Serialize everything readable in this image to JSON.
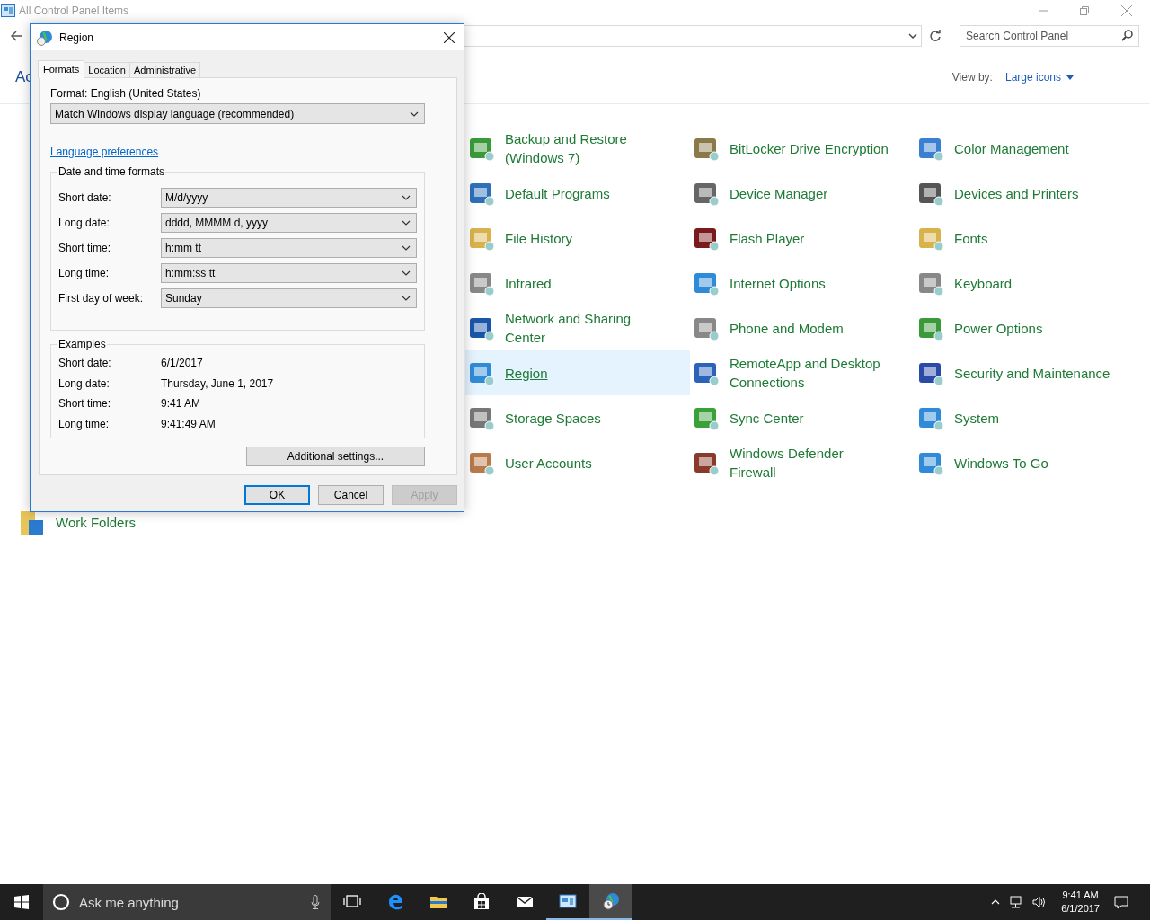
{
  "window": {
    "title": "All Control Panel Items",
    "search": {
      "placeholder": "Search Control Panel"
    }
  },
  "header": {
    "title": "Ac",
    "view_by_label": "View by:",
    "view_by_value": "Large icons"
  },
  "items": [
    {
      "label": "Backup and Restore (Windows 7)",
      "selected": false
    },
    {
      "label": "BitLocker Drive Encryption",
      "selected": false
    },
    {
      "label": "Color Management",
      "selected": false
    },
    {
      "label": "Default Programs",
      "selected": false
    },
    {
      "label": "Device Manager",
      "selected": false
    },
    {
      "label": "Devices and Printers",
      "selected": false
    },
    {
      "label": "File History",
      "selected": false
    },
    {
      "label": "Flash Player",
      "selected": false
    },
    {
      "label": "Fonts",
      "selected": false
    },
    {
      "label": "Infrared",
      "selected": false
    },
    {
      "label": "Internet Options",
      "selected": false
    },
    {
      "label": "Keyboard",
      "selected": false
    },
    {
      "label": "Network and Sharing Center",
      "selected": false
    },
    {
      "label": "Phone and Modem",
      "selected": false
    },
    {
      "label": "Power Options",
      "selected": false
    },
    {
      "label": "Region",
      "selected": true
    },
    {
      "label": "RemoteApp and Desktop Connections",
      "selected": false
    },
    {
      "label": "Security and Maintenance",
      "selected": false
    },
    {
      "label": "Storage Spaces",
      "selected": false
    },
    {
      "label": "Sync Center",
      "selected": false
    },
    {
      "label": "System",
      "selected": false
    },
    {
      "label": "User Accounts",
      "selected": false
    },
    {
      "label": "Windows Defender Firewall",
      "selected": false
    },
    {
      "label": "Windows To Go",
      "selected": false
    }
  ],
  "partial_items": [
    {
      "label": "Work Folders"
    }
  ],
  "dialog": {
    "title": "Region",
    "tabs": [
      {
        "label": "Formats",
        "selected": true
      },
      {
        "label": "Location",
        "selected": false
      },
      {
        "label": "Administrative",
        "selected": false
      }
    ],
    "format_label": "Format: English (United States)",
    "format_value": "Match Windows display language (recommended)",
    "link": "Language preferences",
    "formats_group": {
      "title": "Date and time formats",
      "rows": [
        {
          "label": "Short date:",
          "value": "M/d/yyyy"
        },
        {
          "label": "Long date:",
          "value": "dddd, MMMM d, yyyy"
        },
        {
          "label": "Short time:",
          "value": "h:mm tt"
        },
        {
          "label": "Long time:",
          "value": "h:mm:ss tt"
        },
        {
          "label": "First day of week:",
          "value": "Sunday"
        }
      ]
    },
    "examples_group": {
      "title": "Examples",
      "rows": [
        {
          "label": "Short date:",
          "value": "6/1/2017"
        },
        {
          "label": "Long date:",
          "value": "Thursday, June 1, 2017"
        },
        {
          "label": "Short time:",
          "value": "9:41 AM"
        },
        {
          "label": "Long time:",
          "value": "9:41:49 AM"
        }
      ]
    },
    "additional_button": "Additional settings...",
    "buttons": [
      {
        "label": "OK",
        "default": true,
        "disabled": false
      },
      {
        "label": "Cancel",
        "default": false,
        "disabled": false
      },
      {
        "label": "Apply",
        "default": false,
        "disabled": true
      }
    ]
  },
  "taskbar": {
    "search_placeholder": "Ask me anything",
    "apps": [
      {
        "kind": "taskview",
        "running": false,
        "selected": false
      },
      {
        "kind": "edge",
        "running": false,
        "selected": false
      },
      {
        "kind": "explorer",
        "running": false,
        "selected": false
      },
      {
        "kind": "store",
        "running": false,
        "selected": false
      },
      {
        "kind": "mail",
        "running": false,
        "selected": false
      },
      {
        "kind": "controlpanel",
        "running": true,
        "selected": false
      },
      {
        "kind": "region",
        "running": true,
        "selected": true
      }
    ],
    "clock_time": "9:41 AM",
    "clock_date": "6/1/2017"
  }
}
